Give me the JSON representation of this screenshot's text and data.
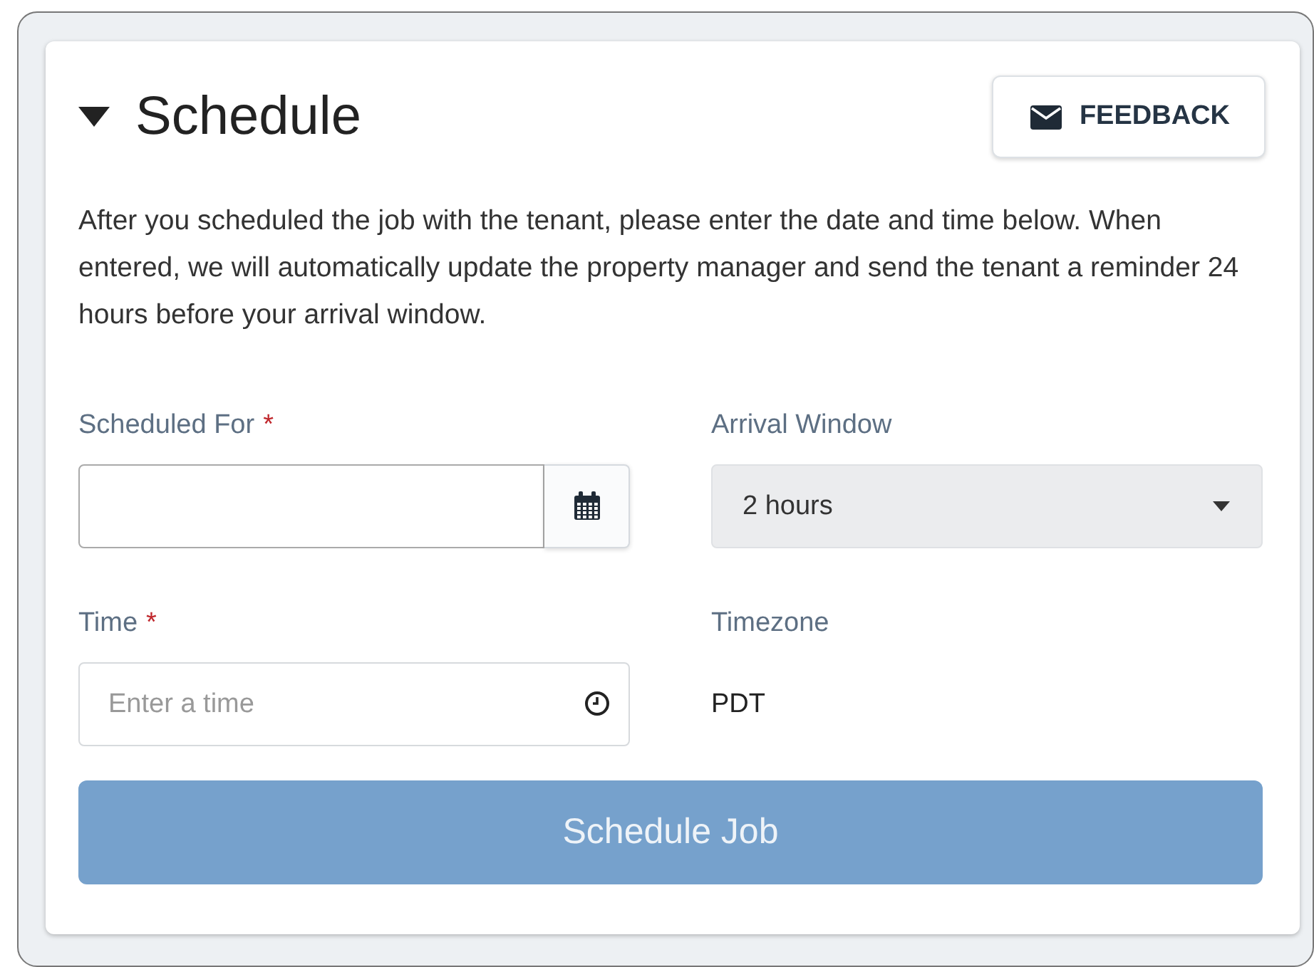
{
  "panel": {
    "title": "Schedule",
    "expanded": true,
    "feedback_button": "FEEDBACK",
    "description": "After you scheduled the job with the tenant, please enter the date and time below. When entered, we will automatically update the property manager and send the tenant a reminder 24 hours before your arrival window."
  },
  "fields": [
    {
      "kind": "date",
      "label": "Scheduled For",
      "required_mark": "*"
    },
    {
      "kind": "select",
      "label": "Arrival Window",
      "value": "2 hours"
    },
    {
      "kind": "time",
      "label": "Time",
      "required_mark": "*",
      "placeholder": "Enter a time"
    },
    {
      "kind": "static",
      "label": "Timezone",
      "value": "PDT"
    }
  ],
  "submit": {
    "label": "Schedule Job",
    "disabled": true
  }
}
